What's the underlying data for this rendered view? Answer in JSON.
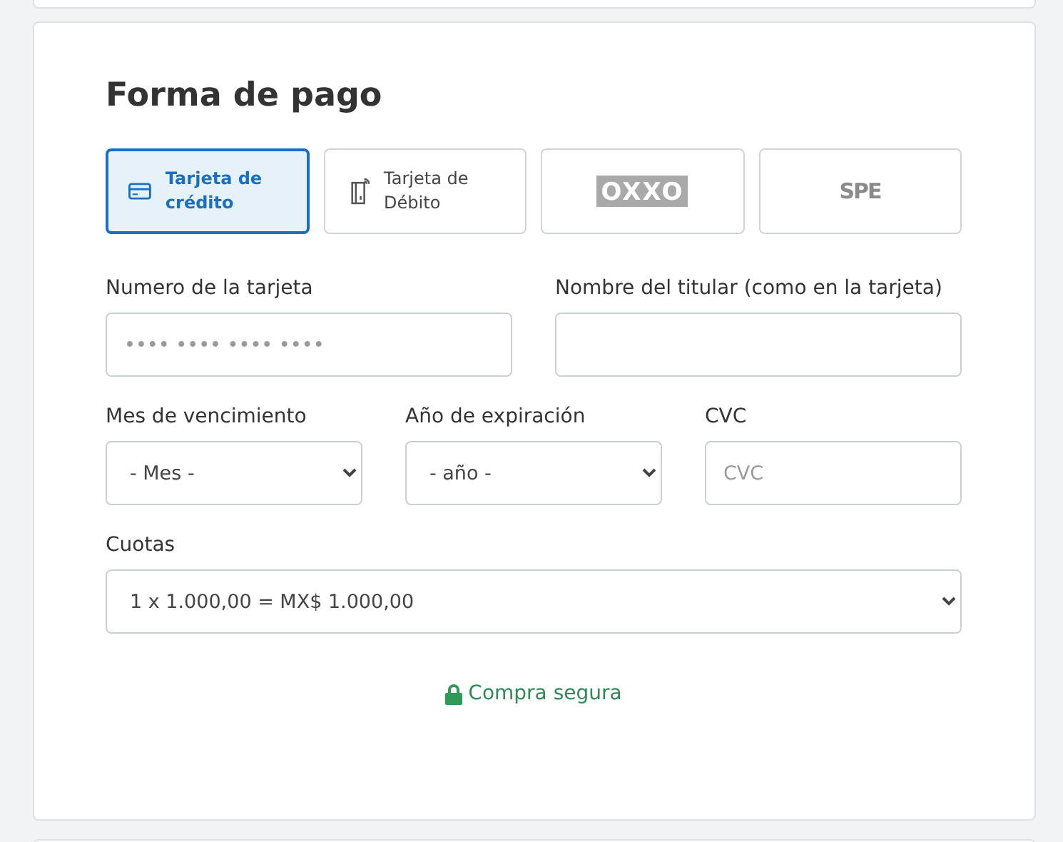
{
  "title": "Forma de pago",
  "methods": [
    {
      "kind": "credit",
      "label": "Tarjeta de crédito",
      "selected": true
    },
    {
      "kind": "debit",
      "label": "Tarjeta de Débito",
      "selected": false
    },
    {
      "kind": "oxxo",
      "label": "OXXO",
      "selected": false
    },
    {
      "kind": "spei",
      "label": "SPE",
      "selected": false
    }
  ],
  "fields": [
    [
      {
        "kind": "input",
        "label": "Numero de la tarjeta",
        "placeholder": "•••• •••• •••• ••••"
      },
      {
        "kind": "input",
        "label": "Nombre del titular (como en la tarjeta)"
      }
    ],
    [
      {
        "kind": "select",
        "label": "Mes de vencimiento",
        "value": "- Mes -"
      },
      {
        "kind": "select",
        "label": "Año de expiración",
        "value": "- año -"
      },
      {
        "kind": "input",
        "label": "CVC",
        "placeholder": "CVC"
      }
    ],
    [
      {
        "kind": "select",
        "label": "Cuotas",
        "value": "1 x 1.000,00 = MX$ 1.000,00"
      }
    ]
  ],
  "secure": "Compra segura"
}
